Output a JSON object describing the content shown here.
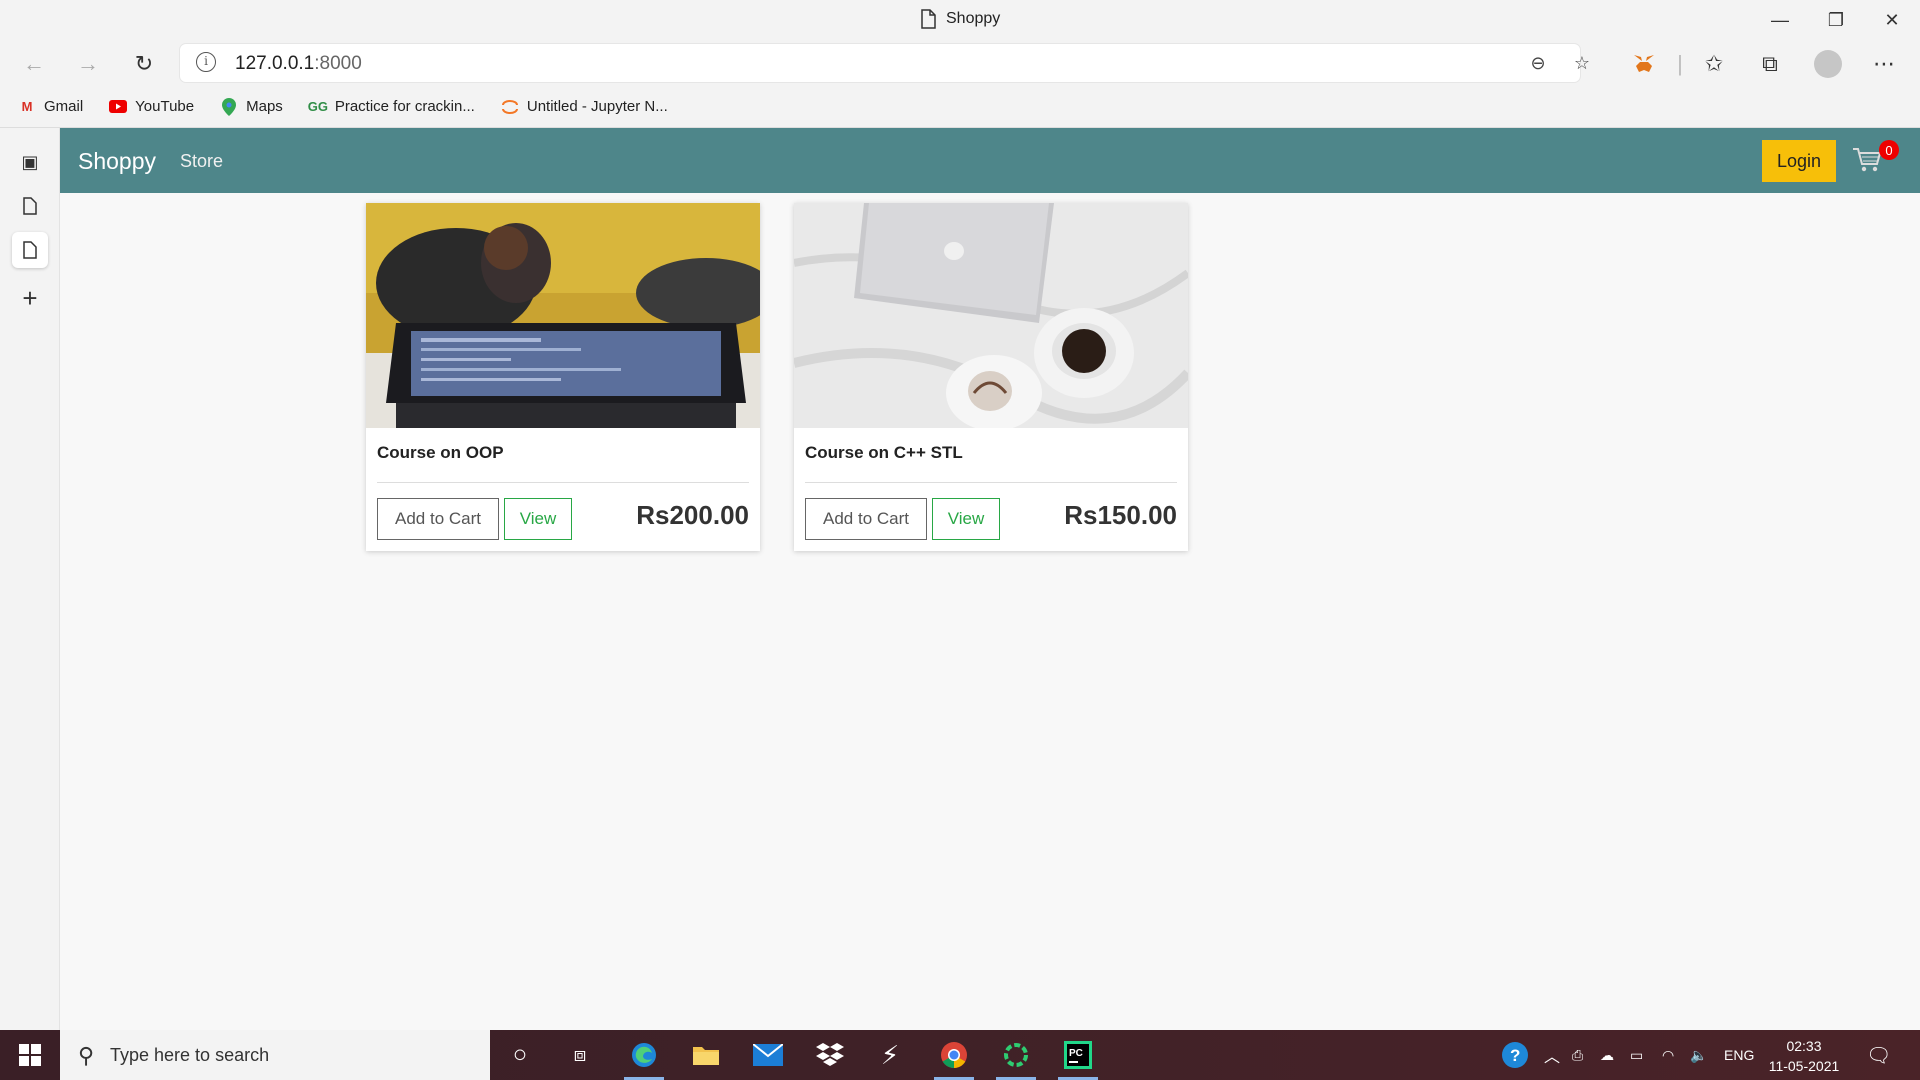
{
  "browser": {
    "tab_title": "Shoppy",
    "url_host": "127.0.0.1",
    "url_port": ":8000",
    "bookmarks": [
      {
        "label": "Gmail",
        "icon": "gmail-icon"
      },
      {
        "label": "YouTube",
        "icon": "youtube-icon"
      },
      {
        "label": "Maps",
        "icon": "maps-icon"
      },
      {
        "label": "Practice for crackin...",
        "icon": "geeksforgeeks-icon"
      },
      {
        "label": "Untitled - Jupyter N...",
        "icon": "jupyter-icon"
      }
    ]
  },
  "site": {
    "brand": "Shoppy",
    "nav_link": "Store",
    "login_label": "Login",
    "cart_count": "0",
    "nav_color": "#4e868a",
    "login_color": "#f7bf09"
  },
  "products": [
    {
      "title": "Course on OOP",
      "add_label": "Add to Cart",
      "view_label": "View",
      "price": "Rs200.00",
      "image": "laptop-code-photo"
    },
    {
      "title": "Course on C++ STL",
      "add_label": "Add to Cart",
      "view_label": "View",
      "price": "Rs150.00",
      "image": "laptop-coffee-photo"
    }
  ],
  "taskbar": {
    "search_placeholder": "Type here to search",
    "language": "ENG",
    "time": "02:33",
    "date": "11-05-2021"
  }
}
